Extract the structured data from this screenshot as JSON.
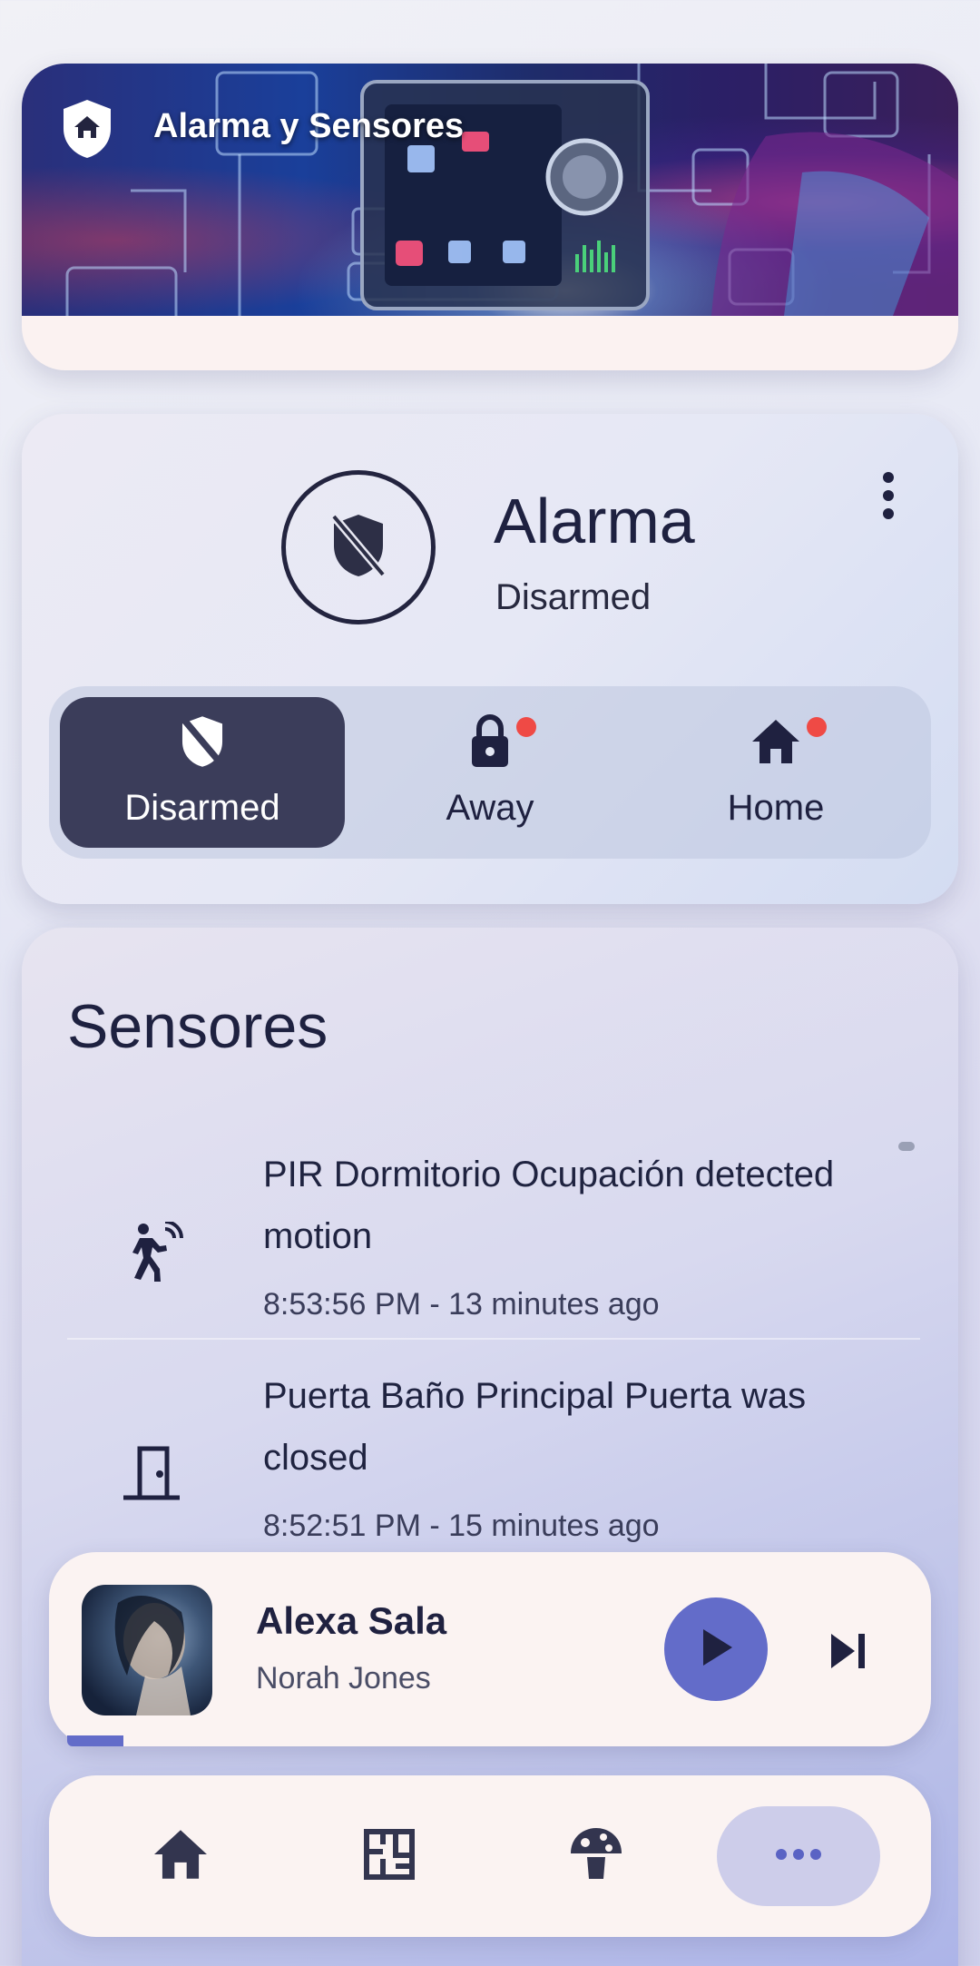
{
  "banner": {
    "title": "Alarma y Sensores",
    "shield_icon": "home-shield-icon"
  },
  "alarm": {
    "title": "Alarma",
    "status": "Disarmed",
    "icon": "shield-off-icon",
    "menu_icon": "more-vert-icon",
    "modes": [
      {
        "label": "Disarmed",
        "icon": "shield-off-icon",
        "active": true,
        "alert": false
      },
      {
        "label": "Away",
        "icon": "lock-icon",
        "active": false,
        "alert": true
      },
      {
        "label": "Home",
        "icon": "home-icon",
        "active": false,
        "alert": true
      }
    ]
  },
  "sensors": {
    "title": "Sensores",
    "events": [
      {
        "icon": "motion-sensor-icon",
        "text": "PIR Dormitorio Ocupación detected motion",
        "time": "8:53:56 PM - 13 minutes ago"
      },
      {
        "icon": "door-icon",
        "text": "Puerta Baño Principal Puerta was closed",
        "time": "8:52:51 PM - 15 minutes ago"
      }
    ]
  },
  "player": {
    "title": "Alexa Sala",
    "artist": "Norah Jones",
    "progress_fraction": 0.06,
    "accent": "#636cc9"
  },
  "nav": {
    "items": [
      {
        "icon": "home-icon",
        "active": false
      },
      {
        "icon": "floorplan-icon",
        "active": false
      },
      {
        "icon": "mushroom-icon",
        "active": false
      },
      {
        "icon": "more-horiz-icon",
        "active": true
      }
    ]
  },
  "colors": {
    "active_mode_bg": "#3b3d5a",
    "alert_dot": "#ef4a45",
    "text_dark": "#1f2140"
  }
}
